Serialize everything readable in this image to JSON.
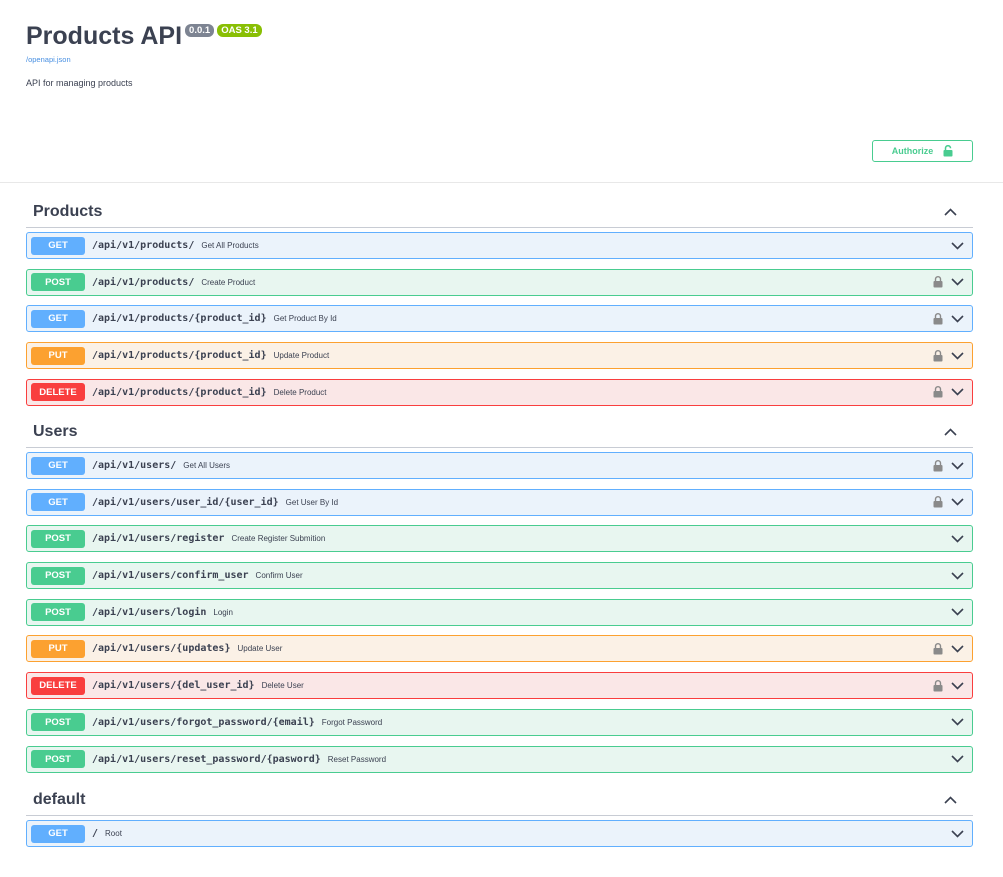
{
  "info": {
    "title": "Products API",
    "version": "0.0.1",
    "oas": "OAS 3.1",
    "spec_link": "/openapi.json",
    "description": "API for managing products"
  },
  "authorize_label": "Authorize",
  "sections": [
    {
      "name": "Products",
      "operations": [
        {
          "method": "GET",
          "path": "/api/v1/products/",
          "summary": "Get All Products",
          "locked": false
        },
        {
          "method": "POST",
          "path": "/api/v1/products/",
          "summary": "Create Product",
          "locked": true
        },
        {
          "method": "GET",
          "path": "/api/v1/products/{product_id}",
          "summary": "Get Product By Id",
          "locked": true
        },
        {
          "method": "PUT",
          "path": "/api/v1/products/{product_id}",
          "summary": "Update Product",
          "locked": true
        },
        {
          "method": "DELETE",
          "path": "/api/v1/products/{product_id}",
          "summary": "Delete Product",
          "locked": true
        }
      ]
    },
    {
      "name": "Users",
      "operations": [
        {
          "method": "GET",
          "path": "/api/v1/users/",
          "summary": "Get All Users",
          "locked": true
        },
        {
          "method": "GET",
          "path": "/api/v1/users/user_id/{user_id}",
          "summary": "Get User By Id",
          "locked": true
        },
        {
          "method": "POST",
          "path": "/api/v1/users/register",
          "summary": "Create Register Submition",
          "locked": false
        },
        {
          "method": "POST",
          "path": "/api/v1/users/confirm_user",
          "summary": "Confirm User",
          "locked": false
        },
        {
          "method": "POST",
          "path": "/api/v1/users/login",
          "summary": "Login",
          "locked": false
        },
        {
          "method": "PUT",
          "path": "/api/v1/users/{updates}",
          "summary": "Update User",
          "locked": true
        },
        {
          "method": "DELETE",
          "path": "/api/v1/users/{del_user_id}",
          "summary": "Delete User",
          "locked": true
        },
        {
          "method": "POST",
          "path": "/api/v1/users/forgot_password/{email}",
          "summary": "Forgot Password",
          "locked": false
        },
        {
          "method": "POST",
          "path": "/api/v1/users/reset_password/{pasword}",
          "summary": "Reset Password",
          "locked": false
        }
      ]
    },
    {
      "name": "default",
      "operations": [
        {
          "method": "GET",
          "path": "/",
          "summary": "Root",
          "locked": false
        }
      ]
    }
  ],
  "colors": {
    "get": "#61affe",
    "post": "#49cc90",
    "put": "#fca130",
    "delete": "#f93e3e"
  }
}
